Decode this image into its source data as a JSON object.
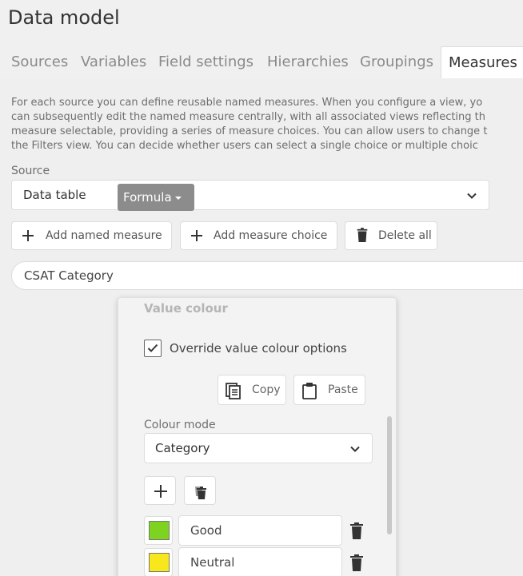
{
  "page_title": "Data model",
  "tabs": [
    {
      "label": "Sources"
    },
    {
      "label": "Variables"
    },
    {
      "label": "Field settings"
    },
    {
      "label": "Hierarchies"
    },
    {
      "label": "Groupings"
    },
    {
      "label": "Measures",
      "active": true
    }
  ],
  "description": [
    "For each source you can define reusable named measures. When you configure a view, yo",
    "can subsequently edit the named measure centrally, with all associated views reflecting th",
    "measure selectable, providing a series of measure choices. You can allow users to change t",
    "the Filters view. You can decide whether users can select a single choice or multiple choic"
  ],
  "source": {
    "label": "Source",
    "value": "Data table"
  },
  "toolbar": {
    "add_named_measure": "Add named measure",
    "add_measure_choice": "Add measure choice",
    "delete_all": "Delete all"
  },
  "measure": {
    "name": "CSAT Category",
    "formula_label": "Formula"
  },
  "popover": {
    "section_title": "Value colour",
    "override_label": "Override value colour options",
    "override_checked": true,
    "copy_label": "Copy",
    "paste_label": "Paste",
    "colour_mode_label": "Colour mode",
    "colour_mode_value": "Category",
    "categories": [
      {
        "label": "Good",
        "color": "#7ed321"
      },
      {
        "label": "Neutral",
        "color": "#f8e71c"
      }
    ]
  }
}
